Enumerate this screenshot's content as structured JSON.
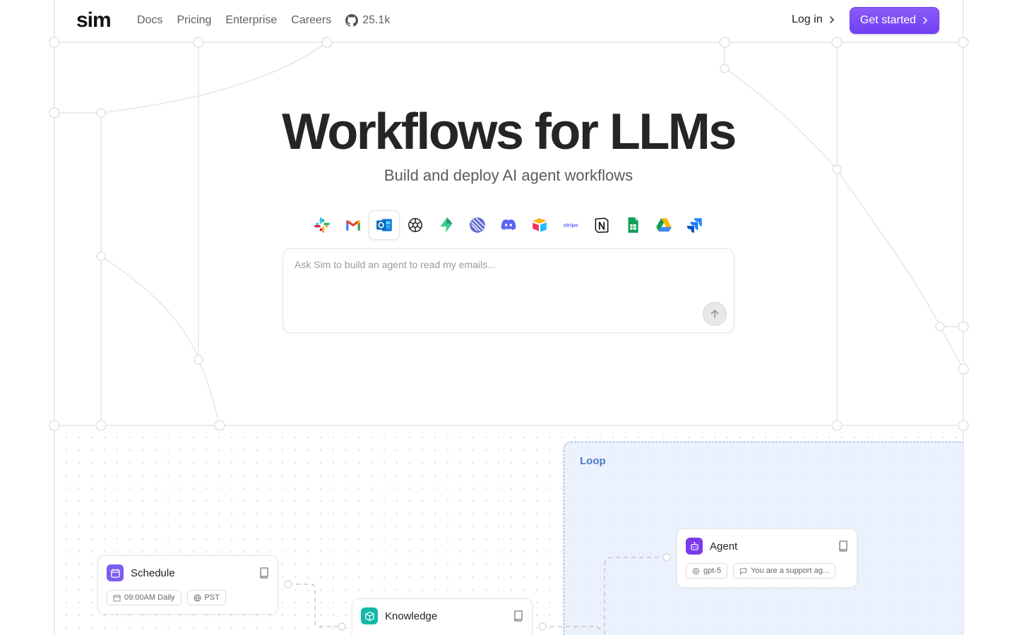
{
  "header": {
    "logo": "sim",
    "nav": [
      "Docs",
      "Pricing",
      "Enterprise",
      "Careers"
    ],
    "github_stars": "25.1k",
    "login_label": "Log in",
    "cta_label": "Get started"
  },
  "hero": {
    "title": "Workflows for LLMs",
    "subtitle": "Build and deploy AI agent workflows"
  },
  "integrations": [
    "slack-icon",
    "gmail-icon",
    "outlook-icon",
    "openai-icon",
    "supabase-icon",
    "linear-icon",
    "discord-icon",
    "airtable-icon",
    "stripe-icon",
    "notion-icon",
    "google-sheets-icon",
    "google-drive-icon",
    "jira-icon"
  ],
  "integrations_stripe_text": "stripe",
  "prompt": {
    "placeholder": "Ask Sim to build an agent to read my emails..."
  },
  "canvas": {
    "loop_label": "Loop",
    "schedule": {
      "title": "Schedule",
      "tags": [
        "09:00AM Daily",
        "PST"
      ]
    },
    "knowledge": {
      "title": "Knowledge"
    },
    "agent": {
      "title": "Agent",
      "tags": [
        "gpt-5",
        "You are a support ag..."
      ]
    }
  },
  "colors": {
    "accent": "#7c4dff",
    "loop_border": "#7a9fd8",
    "loop_label": "#4b79c9",
    "schedule_icon_bg": "#7c5cf0",
    "knowledge_icon_bg": "#14b8a6",
    "agent_icon_bg": "#7c3aed"
  }
}
